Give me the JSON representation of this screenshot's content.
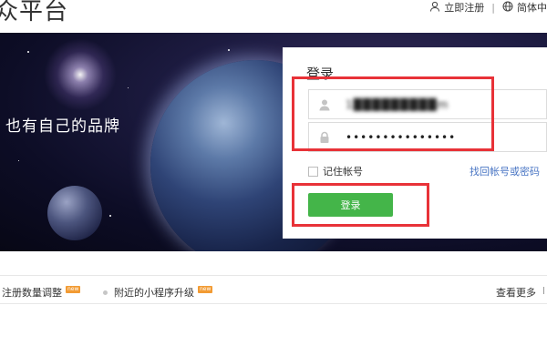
{
  "header": {
    "logo_text": "众平台",
    "register": "立即注册",
    "separator": "|",
    "language": "简体中"
  },
  "hero": {
    "slogan": "也有自己的品牌"
  },
  "login": {
    "title": "登录",
    "username_value": "1█████████m",
    "password_value": "•••••••••••••••",
    "remember_label": "记住帐号",
    "remember_checked": false,
    "forgot_link": "找回帐号或密码",
    "submit_label": "登录"
  },
  "news": {
    "items": [
      {
        "text": "注册数量调整",
        "badge": "new"
      },
      {
        "text": "附近的小程序升级",
        "badge": "new"
      }
    ],
    "more": "查看更多"
  },
  "colors": {
    "accent_green": "#44b549",
    "highlight_red": "#e83238",
    "badge_orange": "#f29b33",
    "link_blue": "#4a76c4"
  }
}
